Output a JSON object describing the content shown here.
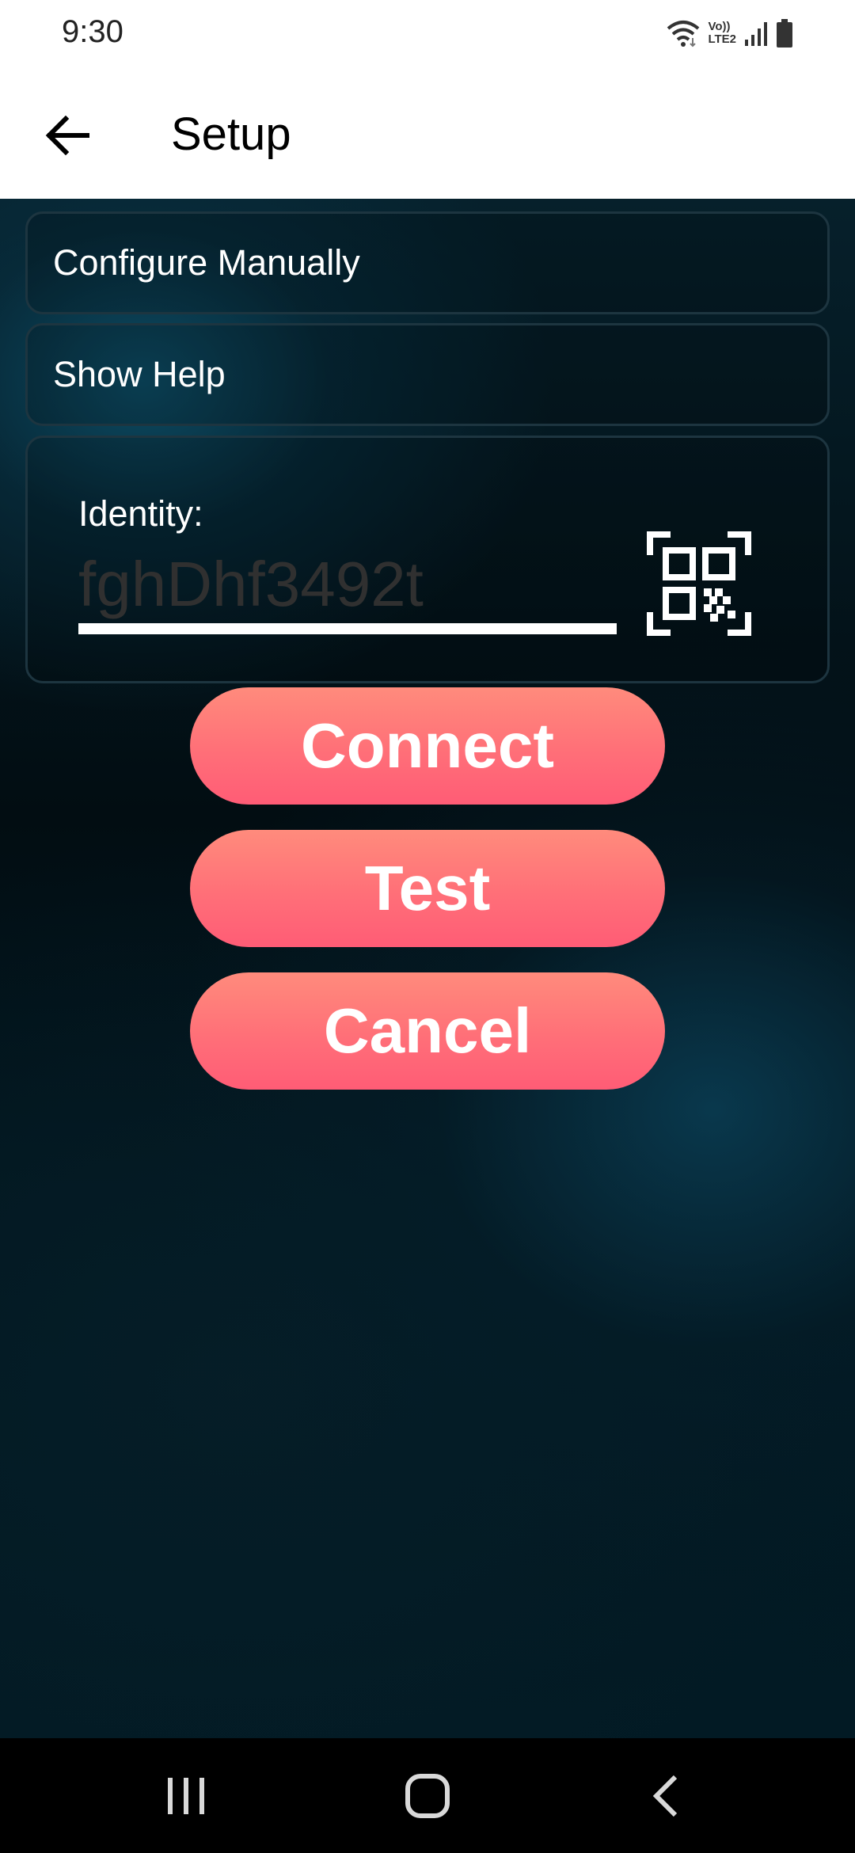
{
  "status_bar": {
    "time": "9:30",
    "network_label_top": "Vo))",
    "network_label_bottom": "LTE2",
    "icons": [
      "wifi-icon",
      "signal-icon",
      "battery-icon"
    ]
  },
  "app_bar": {
    "title": "Setup",
    "back_icon": "arrow-left-icon"
  },
  "menu": {
    "configure_manually": "Configure Manually",
    "show_help": "Show Help"
  },
  "identity": {
    "label": "Identity:",
    "placeholder": "fghDhf3492t",
    "value": "",
    "scan_icon": "qr-code-scan-icon"
  },
  "buttons": {
    "connect": "Connect",
    "test": "Test",
    "cancel": "Cancel"
  },
  "colors": {
    "button_top": "#ff8b7c",
    "button_bottom": "#ff5c76",
    "background_dark": "#020d12",
    "accent_teal": "#0c4b63"
  },
  "nav_bar": {
    "icons": [
      "recent-apps-icon",
      "home-icon",
      "back-icon"
    ]
  }
}
